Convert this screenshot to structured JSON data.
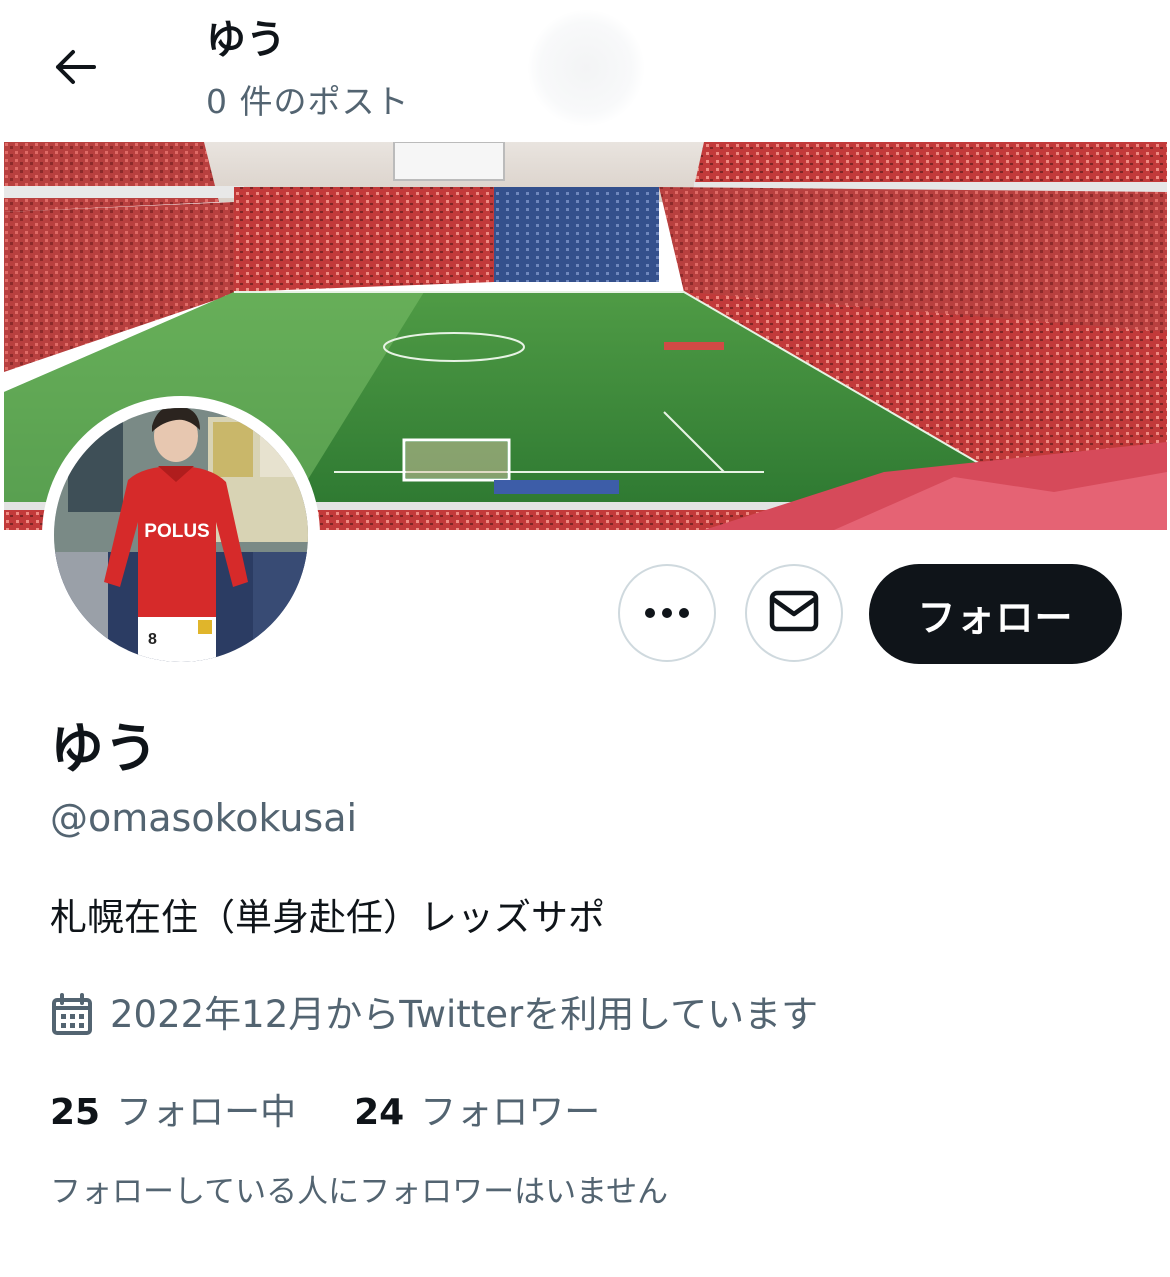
{
  "header": {
    "name": "ゆう",
    "post_count": "0 件のポスト",
    "back_icon": "arrow-left-icon"
  },
  "profile": {
    "display_name": "ゆう",
    "handle": "@omasokokusai",
    "bio": "札幌在住（単身赴任）レッズサポ",
    "joined": "2022年12月からTwitterを利用しています",
    "joined_icon": "calendar-icon",
    "following_count": "25",
    "following_label": "フォロー中",
    "followers_count": "24",
    "followers_label": "フォロワー",
    "mutual_note": "フォローしている人にフォロワーはいません"
  },
  "actions": {
    "more_icon": "more-dots-icon",
    "message_icon": "envelope-icon",
    "follow_label": "フォロー"
  },
  "avatar": {
    "jersey_text": "POLUS",
    "shorts_number": "8"
  },
  "colors": {
    "text_primary": "#0f1419",
    "text_secondary": "#536471",
    "button_dark": "#0f1419",
    "border": "#cfd9de",
    "pitch_green": "#3f8a3c",
    "crowd_red": "#c8322f"
  }
}
